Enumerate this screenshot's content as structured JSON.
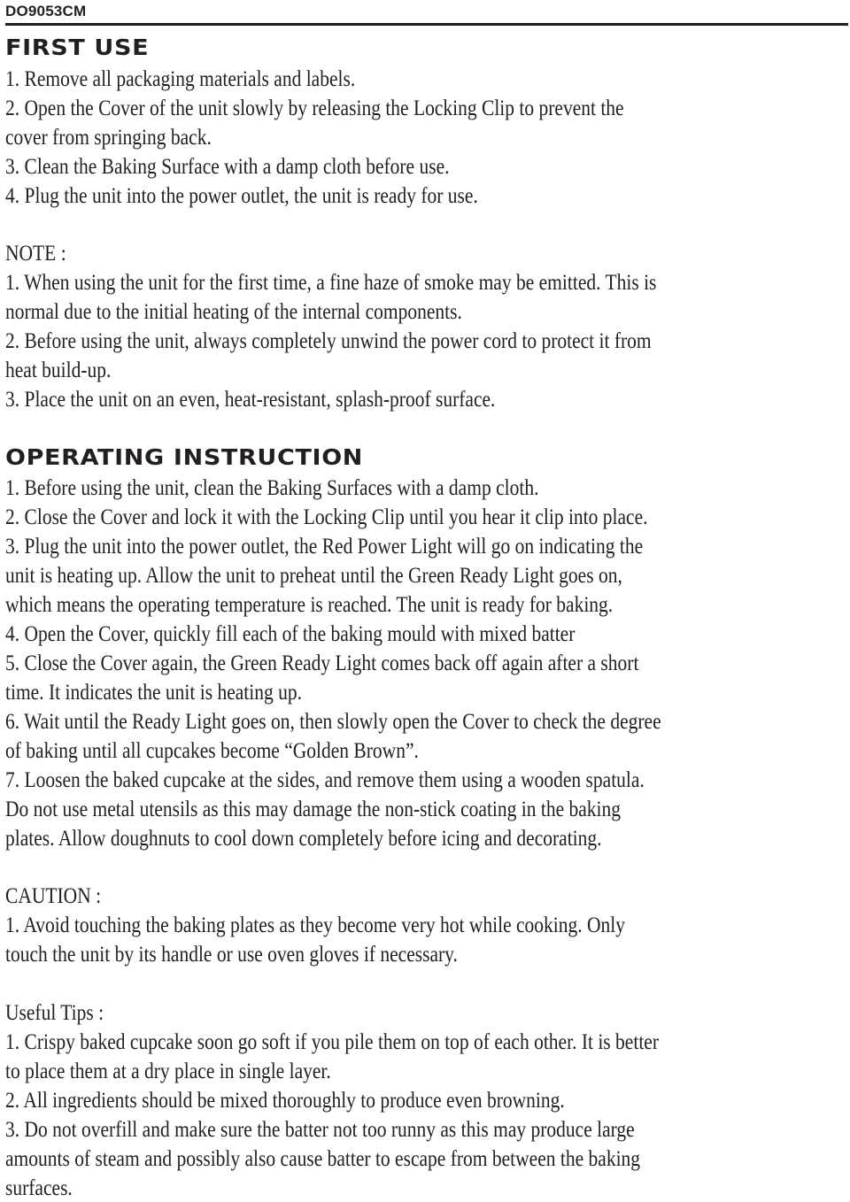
{
  "header": {
    "model_code": "DO9053CM"
  },
  "sections": {
    "first_use": {
      "heading": "First Use",
      "lines": [
        "1. Remove all packaging materials and labels.",
        "2. Open the Cover of the unit slowly by releasing the Locking Clip to prevent the",
        "cover from springing back.",
        "3. Clean the Baking Surface with a damp cloth before use.",
        "4. Plug the unit into the power outlet, the unit is ready for use."
      ]
    },
    "note": {
      "label": "NOTE :",
      "lines": [
        "1. When using the unit for the first time, a fine haze of smoke may be emitted. This is",
        "normal due to the initial heating of the internal components.",
        "2. Before using the unit, always completely unwind the power cord to protect it from",
        "heat build-up.",
        "3. Place the unit on an even, heat-resistant, splash-proof surface."
      ]
    },
    "operating_instruction": {
      "heading": "Operating Instruction",
      "lines": [
        "1. Before using the unit, clean the Baking Surfaces with a damp cloth.",
        "2. Close the Cover and lock it with the Locking Clip until you hear it clip into place.",
        "3. Plug the unit into the power outlet, the Red Power Light will go on indicating the",
        "unit is heating up. Allow the unit to preheat until the Green Ready Light goes on,",
        "which means the operating temperature is reached. The unit is ready for baking.",
        "4. Open the Cover, quickly fill each of the baking mould with mixed batter",
        "5. Close the Cover again, the Green Ready Light comes back off again after a short",
        "time. It indicates the unit is heating up.",
        "6. Wait until the Ready Light goes on, then slowly open the Cover to check the degree",
        "of baking until all cupcakes become “Golden Brown”.",
        "7. Loosen the baked cupcake at the sides, and remove them using a wooden spatula.",
        "Do not use metal utensils as this may damage the non-stick coating in the baking",
        "plates. Allow doughnuts to cool down completely before icing and decorating."
      ]
    },
    "caution": {
      "label": "CAUTION :",
      "lines": [
        "1. Avoid touching the baking plates as they become very hot while cooking. Only",
        "touch the unit by its handle or use oven gloves if necessary."
      ]
    },
    "useful_tips": {
      "label": "Useful Tips :",
      "lines": [
        "1. Crispy baked cupcake soon go soft if you pile them on top of each other. It is better",
        "to place them at a dry place in single layer.",
        "2. All ingredients should be mixed thoroughly to produce even browning.",
        "3. Do not overfill and make sure the batter not too runny as this may produce large",
        "amounts of steam and possibly also cause batter to escape from between the baking",
        "surfaces."
      ]
    }
  }
}
